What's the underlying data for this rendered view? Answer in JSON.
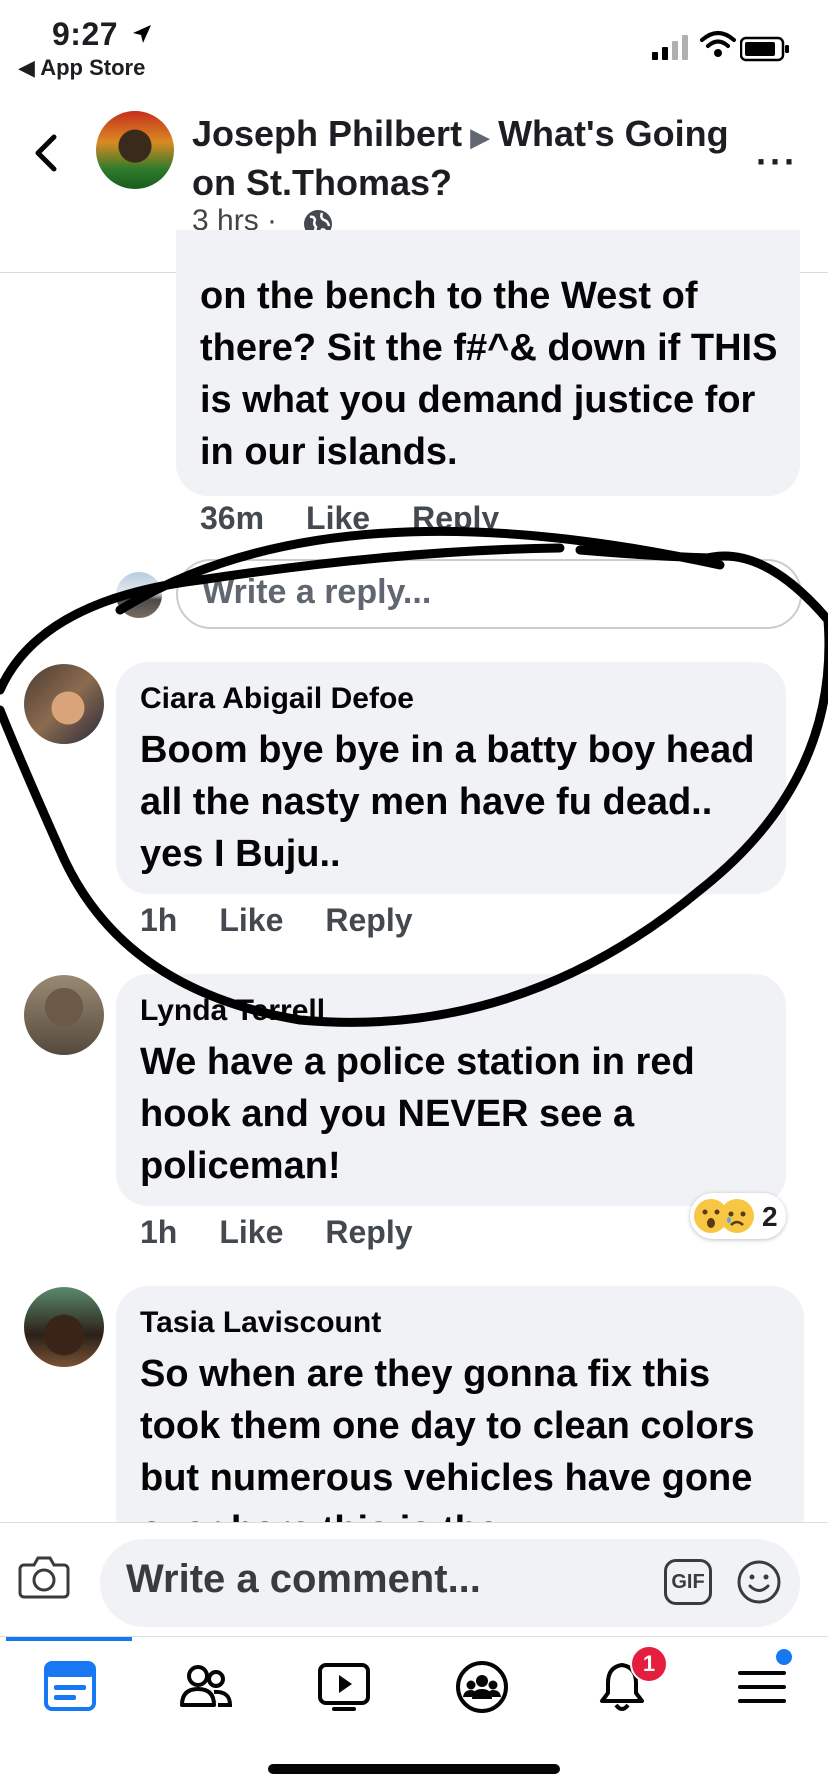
{
  "status_bar": {
    "time": "9:27",
    "back_app": "◀ App Store"
  },
  "header": {
    "author": "Joseph Philbert",
    "separator": "▶",
    "group": "What's Going on St.Thomas?",
    "time": "3 hrs ·",
    "more": "···"
  },
  "previous_comment": {
    "text": "on the bench to the West of there? Sit the f#^& down if THIS is what you demand justice for in our islands.",
    "time": "36m",
    "like": "Like",
    "reply": "Reply"
  },
  "reply_box": {
    "placeholder": "Write a reply..."
  },
  "comments": [
    {
      "name": "Ciara Abigail Defoe",
      "text": "Boom bye bye in a batty boy head all the nasty men have fu dead.. yes I Buju..",
      "time": "1h",
      "like": "Like",
      "reply": "Reply"
    },
    {
      "name": "Lynda Terrell",
      "text": "We have a police station in red hook and you NEVER see a policeman!",
      "time": "1h",
      "like": "Like",
      "reply": "Reply",
      "reaction_count": "2"
    },
    {
      "name": "Tasia Laviscount",
      "text": "So when are they gonna fix this took them one day to clean colors but numerous vehicles have gone over here this is the"
    }
  ],
  "composer": {
    "placeholder": "Write a comment...",
    "gif": "GIF"
  },
  "tabbar": {
    "notification_badge": "1"
  },
  "colors": {
    "accent": "#1877f2",
    "bubble": "#f0f2f5",
    "badge": "#e41e3f"
  }
}
